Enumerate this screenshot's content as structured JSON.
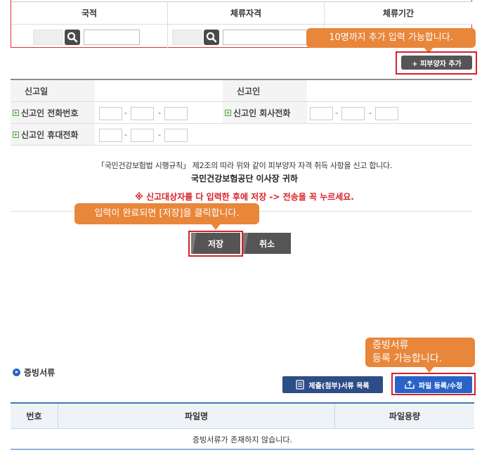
{
  "top_table": {
    "headers": [
      "국적",
      "체류자격",
      "체류기간"
    ]
  },
  "tooltips": {
    "add_dependent": "10명까지 추가 입력 가능합니다.",
    "save_click": "입력이 완료되면 [저장]을 클릭합니다.",
    "evidence_line1": "증빙서류",
    "evidence_line2": "등록 가능합니다."
  },
  "add_dependent_button": "+ 피부양자 추가",
  "report": {
    "report_date_label": "신고일",
    "reporter_label": "신고인",
    "reporter_phone_label": "신고인 전화번호",
    "reporter_company_phone_label": "신고인 회사전화",
    "reporter_mobile_label": "신고인 휴대전화",
    "dash": "-"
  },
  "notice": {
    "regulation_text": "「국민건강보험법 시행규칙」 제2조의 따라 위와 같이 피부양자 자격 취득 사항을 신고 합니다.",
    "addressee": "국민건강보험공단 이사장 귀하",
    "warning": "※ 신고대상자를 다 입력한 후에 저장 -> 전송을 꼭 누르세요."
  },
  "buttons": {
    "save": "저장",
    "cancel": "취소",
    "submitted_docs": "제출(첨부)서류 목록",
    "file_register": "파일 등록/수정"
  },
  "evidence": {
    "section_title": "증빙서류",
    "columns": [
      "번호",
      "파일명",
      "파일용량"
    ],
    "empty_message": "증빙서류가 존재하지 않습니다."
  },
  "colors": {
    "tooltip": "#e8863a",
    "highlight_frame": "#d9202a",
    "blue_button": "#2a63c7",
    "warning_text": "#d9202a"
  }
}
